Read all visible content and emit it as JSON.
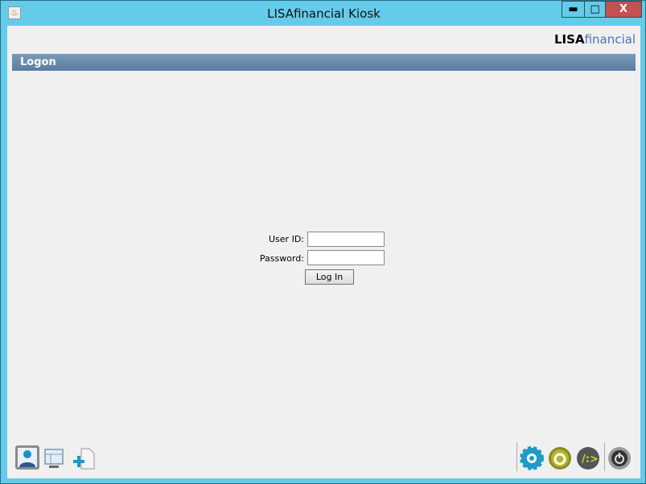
{
  "window": {
    "title": "LISAfinancial Kiosk",
    "minimize": "▬",
    "maximize": "□",
    "close": "X"
  },
  "brand": {
    "bold": "LISA",
    "light": "financial"
  },
  "section": {
    "title": "Logon"
  },
  "form": {
    "user_id_label": "User ID:",
    "user_id_value": "",
    "password_label": "Password:",
    "password_value": "",
    "login_button": "Log In"
  },
  "toolbar_left": [
    "user-icon",
    "window-icon",
    "add-document-icon"
  ],
  "toolbar_right": [
    "settings-icon",
    "refresh-icon",
    "terminal-icon",
    "power-icon"
  ]
}
